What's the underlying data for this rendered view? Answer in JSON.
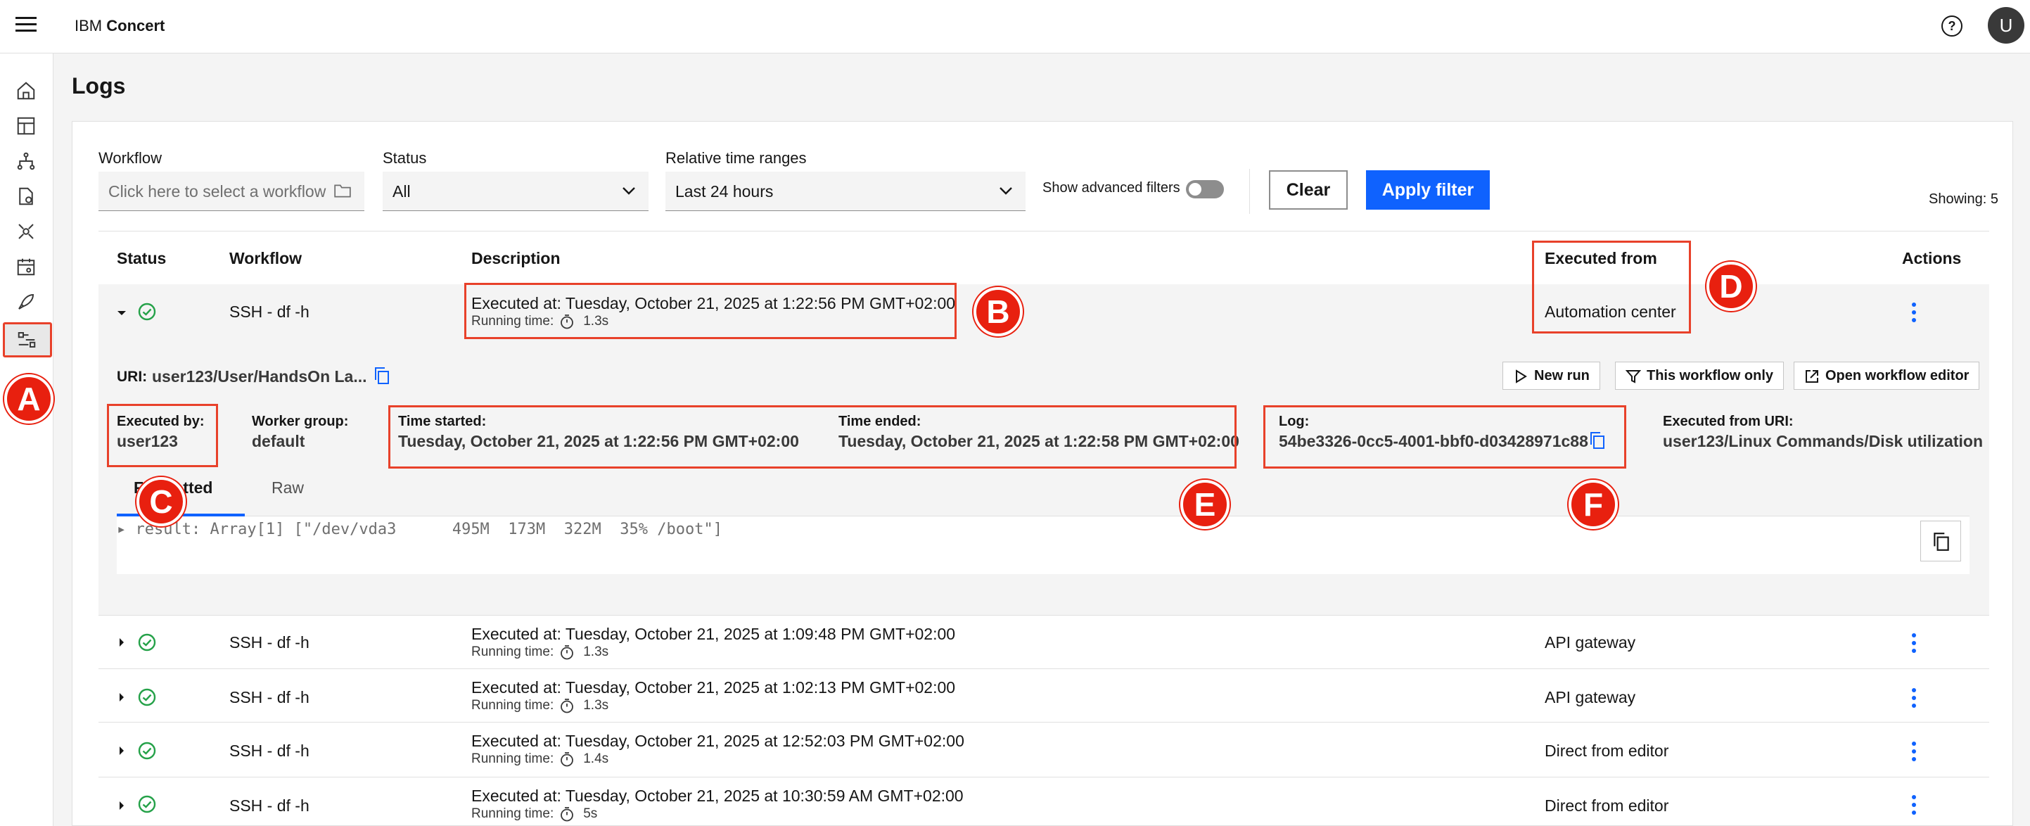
{
  "app": {
    "brand_prefix": "IBM",
    "brand_name": "Concert",
    "avatar_initial": "U"
  },
  "sidenav": {
    "items": [
      "home-icon",
      "dashboard-icon",
      "topology-icon",
      "document-icon",
      "network-icon",
      "calendar-icon",
      "rocket-icon",
      "workflow-icon"
    ]
  },
  "page": {
    "title": "Logs"
  },
  "filters": {
    "workflow_label": "Workflow",
    "workflow_placeholder": "Click here to select a workflow",
    "status_label": "Status",
    "status_value": "All",
    "time_label": "Relative time ranges",
    "time_value": "Last 24 hours",
    "advanced_label": "Show advanced filters",
    "clear_label": "Clear",
    "apply_label": "Apply filter",
    "showing": "Showing: 5"
  },
  "table": {
    "headers": {
      "status": "Status",
      "workflow": "Workflow",
      "description": "Description",
      "executed_from": "Executed from",
      "actions": "Actions"
    },
    "running_label": "Running time:",
    "rows": [
      {
        "workflow": "SSH - df -h",
        "executed_at": "Executed at: Tuesday, October 21, 2025 at 1:22:56 PM GMT+02:00",
        "running_time": "1.3s",
        "executed_from": "Automation center"
      },
      {
        "workflow": "SSH - df -h",
        "executed_at": "Executed at: Tuesday, October 21, 2025 at 1:09:48 PM GMT+02:00",
        "running_time": "1.3s",
        "executed_from": "API gateway"
      },
      {
        "workflow": "SSH - df -h",
        "executed_at": "Executed at: Tuesday, October 21, 2025 at 1:02:13 PM GMT+02:00",
        "running_time": "1.3s",
        "executed_from": "API gateway"
      },
      {
        "workflow": "SSH - df -h",
        "executed_at": "Executed at: Tuesday, October 21, 2025 at 12:52:03 PM GMT+02:00",
        "running_time": "1.4s",
        "executed_from": "Direct from editor"
      },
      {
        "workflow": "SSH - df -h",
        "executed_at": "Executed at: Tuesday, October 21, 2025 at 10:30:59 AM GMT+02:00",
        "running_time": "5s",
        "executed_from": "Direct from editor"
      }
    ]
  },
  "details": {
    "uri_label": "URI:",
    "uri_value": "user123/User/HandsOn La...",
    "new_run": "New run",
    "this_workflow_only": "This workflow only",
    "open_editor": "Open workflow editor",
    "executed_by_label": "Executed by:",
    "executed_by_value": "user123",
    "worker_group_label": "Worker group:",
    "worker_group_value": "default",
    "time_started_label": "Time started:",
    "time_started_value": "Tuesday, October 21, 2025 at 1:22:56 PM GMT+02:00",
    "time_ended_label": "Time ended:",
    "time_ended_value": "Tuesday, October 21, 2025 at 1:22:58 PM GMT+02:00",
    "log_label": "Log:",
    "log_value": "54be3326-0cc5-4001-bbf0-d03428971c88",
    "executed_from_uri_label": "Executed from URI:",
    "executed_from_uri_value": "user123/Linux Commands/Disk utilization",
    "tab_formatted": "Formatted",
    "tab_raw": "Raw",
    "output": "▸ result: Array[1] [\"/dev/vda3      495M  173M  322M  35% /boot\"]"
  },
  "callouts": {
    "a": "A",
    "b": "B",
    "c": "C",
    "d": "D",
    "e": "E",
    "f": "F"
  },
  "colors": {
    "accent": "#0f62fe",
    "success": "#24a148",
    "callout": "#e8412a"
  }
}
